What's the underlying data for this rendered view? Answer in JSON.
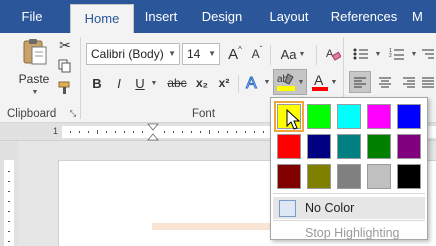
{
  "tabs": [
    "File",
    "Home",
    "Insert",
    "Design",
    "Layout",
    "References",
    "M"
  ],
  "clipboard": {
    "paste_label": "Paste",
    "group_label": "Clipboard"
  },
  "font": {
    "family": "Calibri (Body)",
    "size": "14",
    "grow_label": "A",
    "shrink_label": "A",
    "case_label": "Aa",
    "bold": "B",
    "italic": "I",
    "underline": "U",
    "strike": "abc",
    "subscript": "x₂",
    "superscript": "x²",
    "group_label": "Font"
  },
  "ruler": {
    "number": "1"
  },
  "highlight_menu": {
    "colors": [
      "#ffff00",
      "#00ff00",
      "#00ffff",
      "#ff00ff",
      "#0000ff",
      "#ff0000",
      "#000080",
      "#008080",
      "#008000",
      "#800080",
      "#800000",
      "#808000",
      "#808080",
      "#c0c0c0",
      "#000000"
    ],
    "selected_color": "#ffff00",
    "no_color_label": "No Color",
    "stop_label": "Stop Highlighting"
  },
  "colors": {
    "tab_bar": "#2b579a",
    "highlight_accent": "#ffff00",
    "font_color_accent": "#ff0000"
  }
}
